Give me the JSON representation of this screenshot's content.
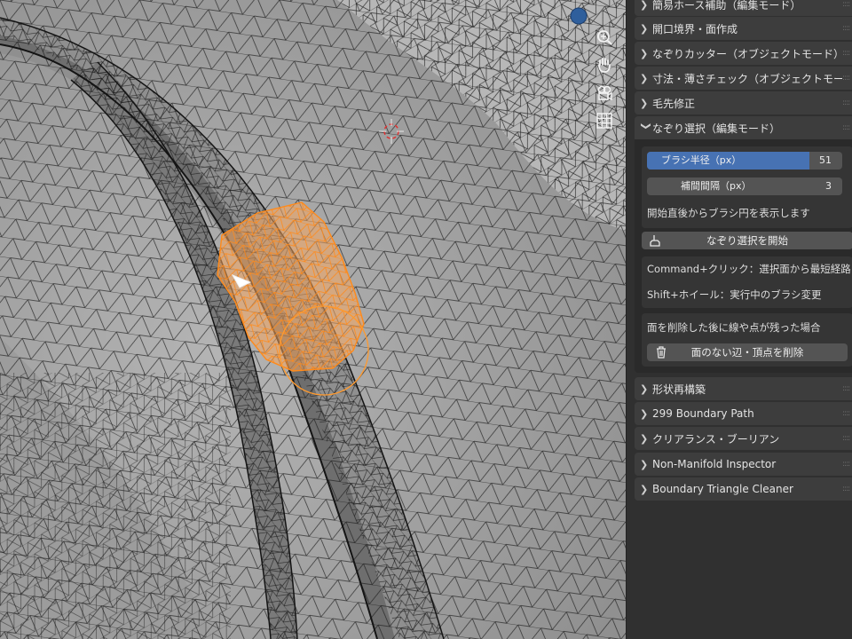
{
  "viewport": {
    "gizmos": [
      "zoom-icon",
      "hand-icon",
      "camera-icon",
      "grid-icon"
    ],
    "colors": {
      "mesh_face": "#a9a9a9",
      "wire": "#1a1a1a",
      "selection": "#ff9a2e",
      "view_dot": "#2f5f9c"
    }
  },
  "sidebar": {
    "panels": [
      {
        "label": "簡易ホース補助（編集モード）",
        "expanded": false
      },
      {
        "label": "開口境界・面作成",
        "expanded": false
      },
      {
        "label": "なぞりカッター（オブジェクトモード）",
        "expanded": false
      },
      {
        "label": "寸法・薄さチェック（オブジェクトモー",
        "expanded": false
      },
      {
        "label": "毛先修正",
        "expanded": false
      },
      {
        "label": "なぞり選択（編集モード）",
        "expanded": true
      },
      {
        "label": "形状再構築",
        "expanded": false
      },
      {
        "label": "299 Boundary Path",
        "expanded": false
      },
      {
        "label": "クリアランス・ブーリアン",
        "expanded": false
      },
      {
        "label": "Non-Manifold Inspector",
        "expanded": false
      },
      {
        "label": "Boundary Triangle Cleaner",
        "expanded": false
      }
    ],
    "trace_select": {
      "brush_radius": {
        "label": "ブラシ半径（px）",
        "value": "51",
        "fraction": 0.83
      },
      "interp_interval": {
        "label": "補間間隔（px）",
        "value": "3"
      },
      "note_show_circle": "開始直後からブラシ円を表示します",
      "start_button": "なぞり選択を開始",
      "hint_command": "Command+クリック：選択面から最短経路",
      "hint_shift": "Shift+ホイール：実行中のブラシ変更",
      "cleanup_note": "面を削除した後に線や点が残った場合",
      "cleanup_button": "面のない辺・頂点を削除"
    }
  }
}
